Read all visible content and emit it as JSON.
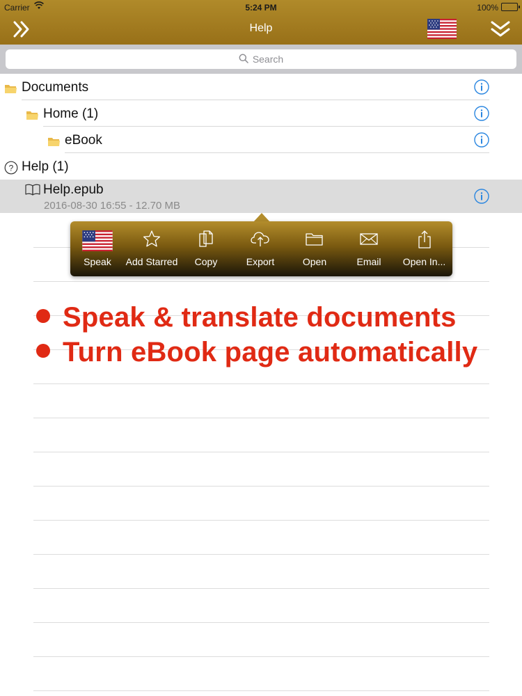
{
  "status_bar": {
    "carrier": "Carrier",
    "time": "5:24 PM",
    "battery": "100%"
  },
  "nav": {
    "title": "Help",
    "left_icon": "double-chevron-right-icon",
    "flag_icon": "us-flag-icon",
    "right_icon": "double-chevron-down-icon"
  },
  "search": {
    "placeholder": "Search"
  },
  "tree": [
    {
      "label": "Documents",
      "icon": "folder-icon"
    },
    {
      "label": "Home (1)",
      "icon": "folder-icon"
    },
    {
      "label": "eBook",
      "icon": "folder-icon"
    },
    {
      "label": "Help (1)",
      "icon": "question-circle-icon"
    }
  ],
  "file": {
    "name": "Help.epub",
    "meta": "2016-08-30 16:55 - 12.70 MB",
    "icon": "book-icon"
  },
  "popover": {
    "items": [
      {
        "label": "Speak",
        "icon": "us-flag-icon"
      },
      {
        "label": "Add Starred",
        "icon": "star-icon"
      },
      {
        "label": "Copy",
        "icon": "copy-icon"
      },
      {
        "label": "Export",
        "icon": "cloud-upload-icon"
      },
      {
        "label": "Open",
        "icon": "folder-open-icon"
      },
      {
        "label": "Email",
        "icon": "envelope-icon"
      },
      {
        "label": "Open In...",
        "icon": "share-icon"
      }
    ]
  },
  "promo": {
    "line1": "Speak & translate documents",
    "line2": "Turn eBook page automatically"
  },
  "colors": {
    "nav_gold": "#b08a2a",
    "promo_red": "#e02a14",
    "info_blue": "#2a86e0"
  }
}
